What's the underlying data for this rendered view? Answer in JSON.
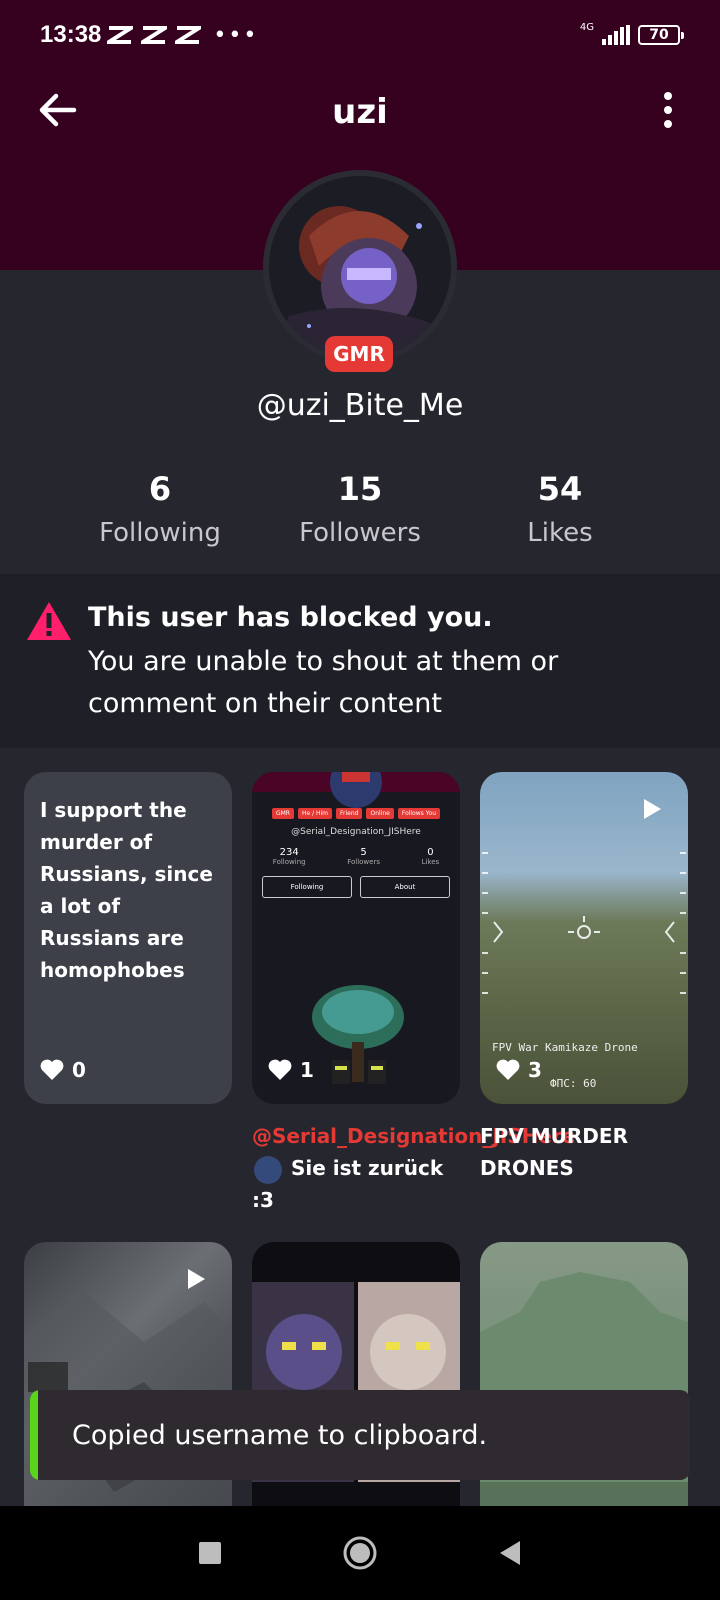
{
  "status_bar": {
    "time": "13:38",
    "dots": "•••",
    "network": "4G",
    "battery": "70"
  },
  "app_bar": {
    "title": "uzi"
  },
  "profile": {
    "badge": "GMR",
    "handle": "@uzi_Bite_Me",
    "stats": [
      {
        "value": "6",
        "label": "Following"
      },
      {
        "value": "15",
        "label": "Followers"
      },
      {
        "value": "54",
        "label": "Likes"
      }
    ]
  },
  "blocked_notice": {
    "title": "This user has blocked you.",
    "body": "You are unable to shout at them or comment on their content",
    "icon_color": "#ff1f6b"
  },
  "posts": [
    {
      "type": "text",
      "text": "I support the murder of Russians, since a lot of Russians are homophobes",
      "likes": "0"
    },
    {
      "type": "image",
      "likes": "1",
      "caption_mention": "@Serial_Designation_JISHere",
      "caption_text": "Sie ist zurück :3",
      "thumb": {
        "pills": [
          "GMR",
          "He / Him",
          "Friend",
          "Online",
          "Follows You"
        ],
        "user": "@Serial_Designation_JISHere",
        "stats": [
          {
            "v": "234",
            "l": "Following"
          },
          {
            "v": "5",
            "l": "Followers"
          },
          {
            "v": "0",
            "l": "Likes"
          }
        ],
        "buttons": [
          "Following",
          "About"
        ]
      }
    },
    {
      "type": "video",
      "likes": "3",
      "caption_text": "FPV MURDER DRONES",
      "overlay_text": "FPV War Kamikaze Drone",
      "overlay_sub": "ФПС: 60"
    },
    {
      "type": "video"
    },
    {
      "type": "image"
    },
    {
      "type": "image"
    }
  ],
  "toast": {
    "message": "Copied username to clipboard.",
    "accent_color": "#5bd51c"
  },
  "colors": {
    "header": "#35011f",
    "background": "#26272e",
    "accent_red": "#e53935"
  }
}
